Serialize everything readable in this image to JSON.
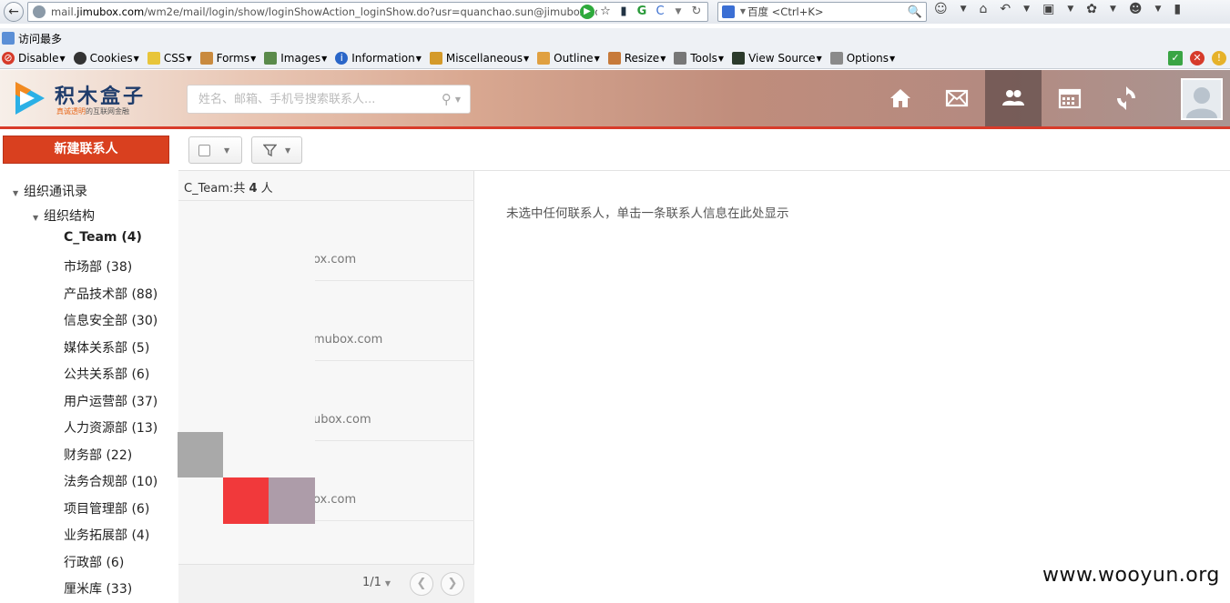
{
  "browser": {
    "url_prefix": "mail.",
    "url_domain": "jimubox.com",
    "url_rest": "/wm2e/mail/login/show/loginShowAction_loginShow.do?usr=quanchao.sun@jimubox.cor",
    "search_placeholder": "百度 <Ctrl+K>",
    "bookmark": "访问最多",
    "dev_toolbar": [
      "Disable",
      "Cookies",
      "CSS",
      "Forms",
      "Images",
      "Information",
      "Miscellaneous",
      "Outline",
      "Resize",
      "Tools",
      "View Source",
      "Options"
    ]
  },
  "header": {
    "logo_title": "积木盒子",
    "logo_sub_accent": "真诚透明",
    "logo_sub_rest": "的互联网金融",
    "search_placeholder": "姓名、邮箱、手机号搜索联系人..."
  },
  "sidebar": {
    "new_contact": "新建联系人",
    "root": "组织通讯录",
    "org": "组织结构",
    "departments": [
      {
        "label": "C_Team (4)",
        "selected": true
      },
      {
        "label": "市场部 (38)"
      },
      {
        "label": "产品技术部 (88)"
      },
      {
        "label": "信息安全部 (30)"
      },
      {
        "label": "媒体关系部 (5)"
      },
      {
        "label": "公共关系部 (6)"
      },
      {
        "label": "用户运营部 (37)"
      },
      {
        "label": "人力资源部 (13)"
      },
      {
        "label": "财务部 (22)"
      },
      {
        "label": "法务合规部 (10)"
      },
      {
        "label": "项目管理部 (6)"
      },
      {
        "label": "业务拓展部 (4)"
      },
      {
        "label": "行政部 (6)"
      },
      {
        "label": "厘米库 (33)"
      }
    ]
  },
  "list": {
    "group": "C_Team:共",
    "count": "4",
    "unit": "人",
    "contacts": [
      {
        "email": "ox.com"
      },
      {
        "email": "mubox.com"
      },
      {
        "email": "ubox.com"
      },
      {
        "email": "ox.com"
      }
    ],
    "page": "1/1"
  },
  "detail": {
    "empty": "未选中任何联系人，单击一条联系人信息在此处显示"
  },
  "watermark": "www.wooyun.org"
}
